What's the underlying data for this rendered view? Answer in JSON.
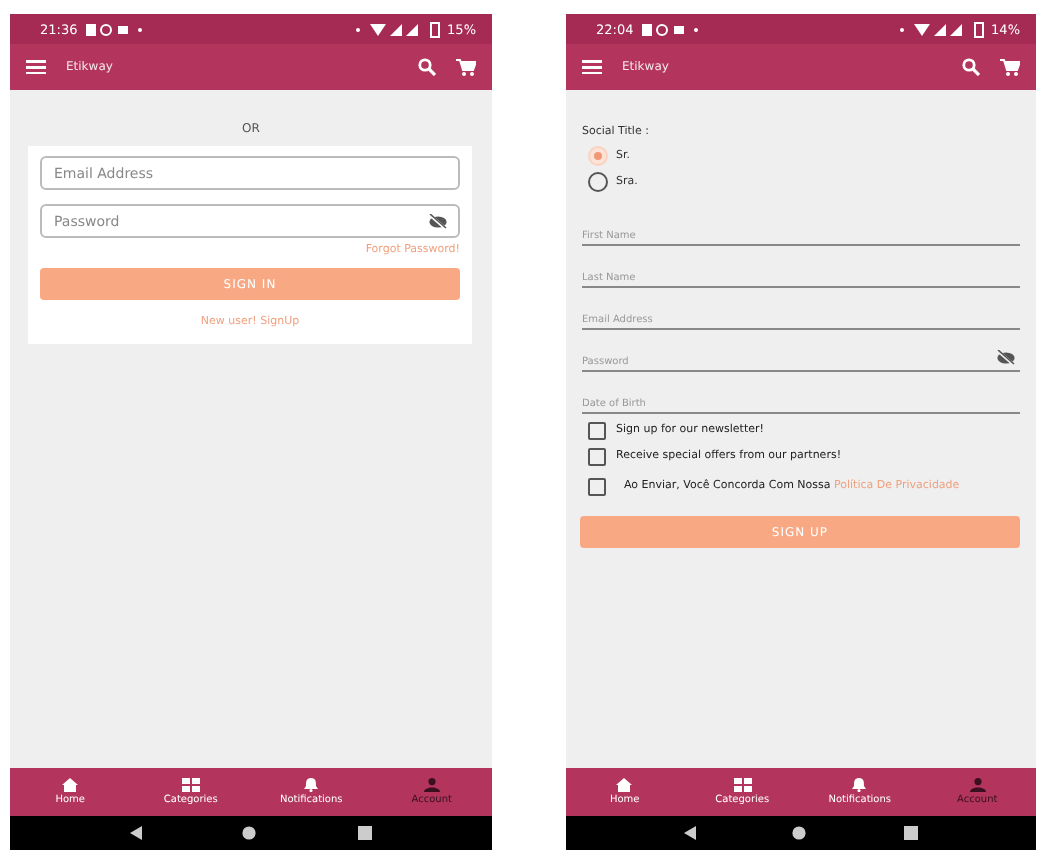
{
  "screens": [
    {
      "kind": "login",
      "status_bar": {
        "time": "21:36",
        "battery": "15%"
      },
      "app_bar": {
        "title": "Etikway"
      },
      "divider_text": "OR",
      "fields": [
        {
          "placeholder": "Email Address",
          "kind": "text"
        },
        {
          "placeholder": "Password",
          "kind": "password"
        }
      ],
      "forgot_link": "Forgot Password!",
      "submit": "SIGN IN",
      "signup_link": "New user! SignUp",
      "nav": [
        {
          "label": "Home",
          "selected": false
        },
        {
          "label": "Categories",
          "selected": false
        },
        {
          "label": "Notifications",
          "selected": false
        },
        {
          "label": "Account",
          "selected": true
        }
      ]
    },
    {
      "kind": "signup",
      "status_bar": {
        "time": "22:04",
        "battery": "14%"
      },
      "app_bar": {
        "title": "Etikway"
      },
      "social_title": "Social Title :",
      "titles": [
        {
          "label": "Sr.",
          "selected": true
        },
        {
          "label": "Sra.",
          "selected": false
        }
      ],
      "fields": [
        {
          "placeholder": "First Name",
          "kind": "text"
        },
        {
          "placeholder": "Last Name",
          "kind": "text"
        },
        {
          "placeholder": "Email Address",
          "kind": "text"
        },
        {
          "placeholder": "Password",
          "kind": "password"
        },
        {
          "placeholder": "Date of Birth",
          "kind": "text"
        }
      ],
      "checkboxes": [
        {
          "label": "Sign up for our newsletter!",
          "checked": false
        },
        {
          "label": "Receive special offers from our partners!",
          "checked": false
        },
        {
          "label": "Ao Enviar, Você Concorda Com Nossa",
          "link": "Política De Privacidade",
          "checked": false
        }
      ],
      "submit": "SIGN UP",
      "nav": [
        {
          "label": "Home",
          "selected": false
        },
        {
          "label": "Categories",
          "selected": false
        },
        {
          "label": "Notifications",
          "selected": false
        },
        {
          "label": "Account",
          "selected": true
        }
      ]
    }
  ]
}
